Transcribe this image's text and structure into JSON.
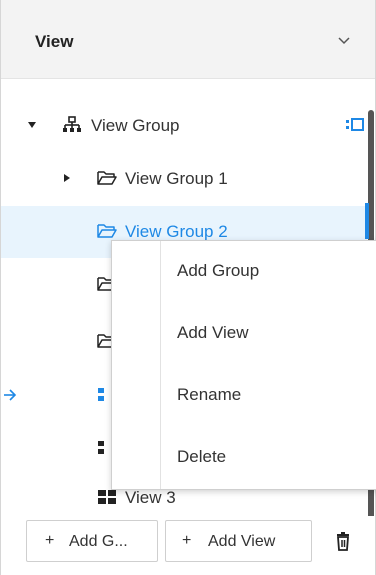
{
  "header": {
    "title": "View"
  },
  "tree": {
    "root": {
      "label": "View Group"
    },
    "group1": {
      "label": "View Group 1"
    },
    "group2": {
      "label": "View Group 2"
    },
    "view3": {
      "label": "View 3"
    }
  },
  "context_menu": {
    "items": [
      {
        "label": "Add Group"
      },
      {
        "label": "Add View"
      },
      {
        "label": "Rename"
      },
      {
        "label": "Delete"
      }
    ]
  },
  "footer": {
    "add_group_label": "Add G...",
    "add_view_label": "Add View",
    "plus": "+"
  },
  "colors": {
    "accent": "#1e88e5",
    "selected_bg": "#e8f4fd"
  }
}
